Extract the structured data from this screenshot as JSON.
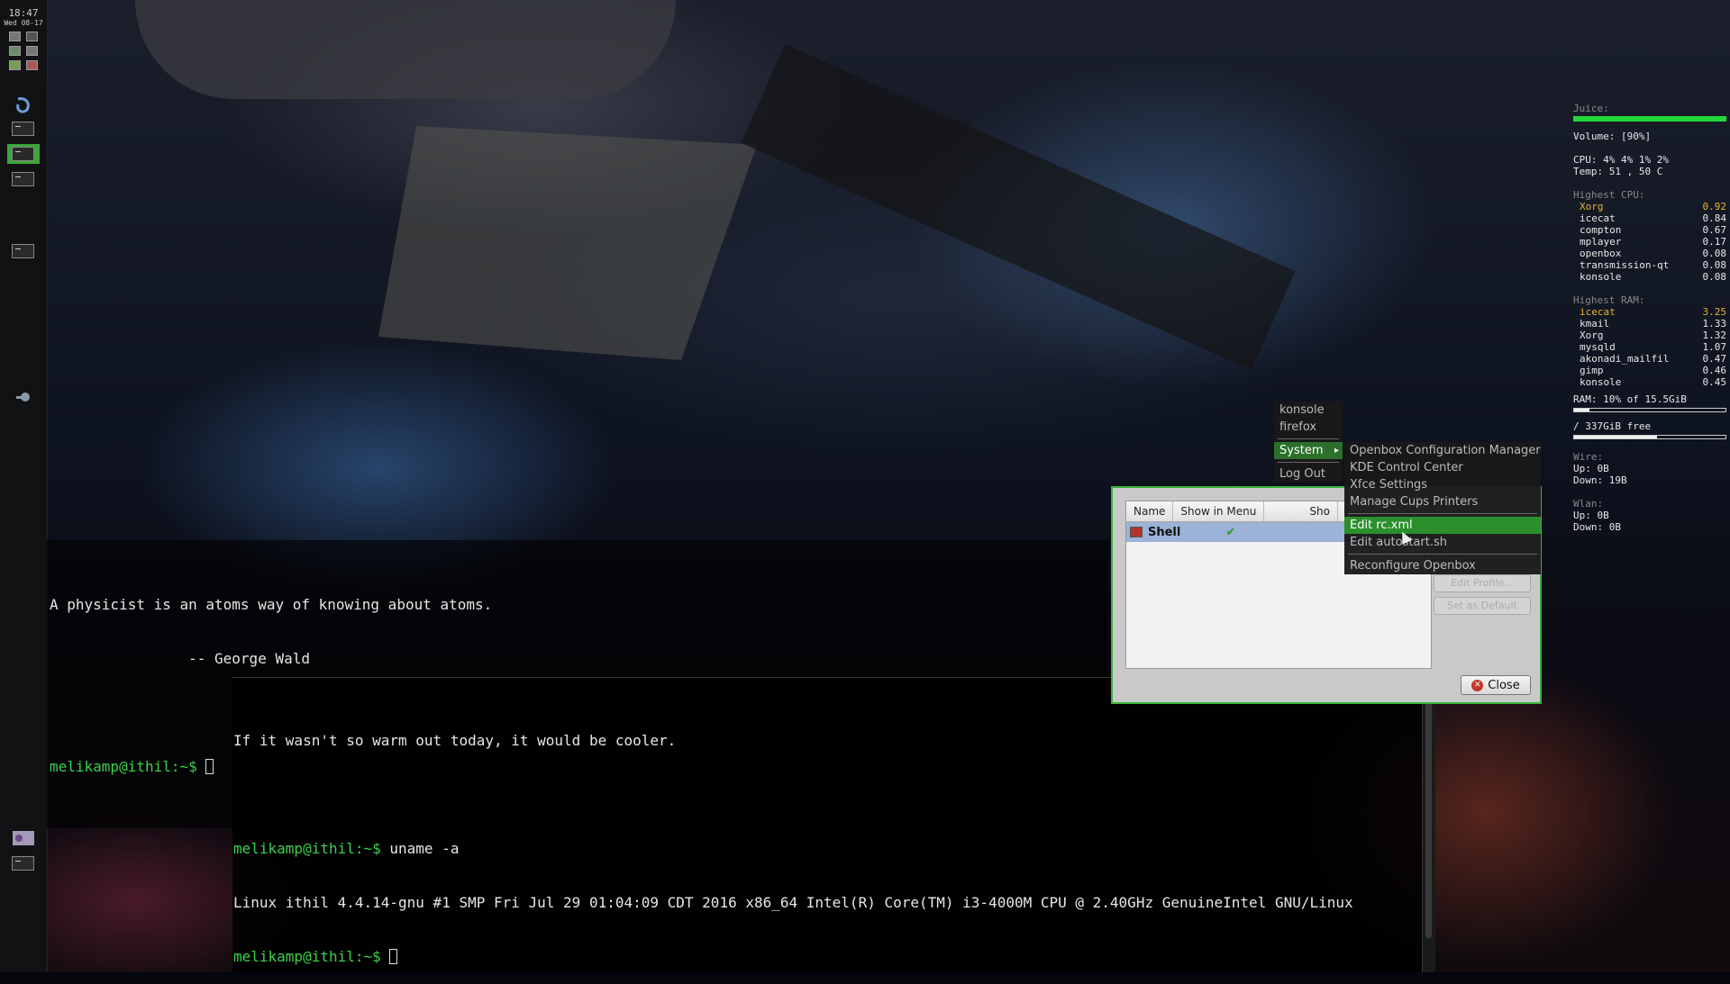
{
  "panel": {
    "clock_time": "18:47",
    "clock_date": "Wed 08-17"
  },
  "terminal1": {
    "quote_line1": "A physicist is an atoms way of knowing about atoms.",
    "quote_line2": "                -- George Wald",
    "prompt": "melikamp@ithil:~$ "
  },
  "terminal2": {
    "quote": "If it wasn't so warm out today, it would be cooler.",
    "prompt1": "melikamp@ithil:~$ ",
    "command": "uname -a",
    "output": "Linux ithil 4.4.14-gnu #1 SMP Fri Jul 29 01:04:09 CDT 2016 x86_64 Intel(R) Core(TM) i3-4000M CPU @ 2.40GHz GenuineIntel GNU/Linux",
    "prompt2": "melikamp@ithil:~$ "
  },
  "conky": {
    "juice_label": "Juice:",
    "juice_level": 1.0,
    "volume": "Volume: [90%]",
    "cpu": "CPU: 4% 4% 1% 2%",
    "temp": "Temp: 51 , 50  C",
    "highest_cpu_label": "Highest CPU:",
    "cpu_procs": [
      {
        "name": "Xorg",
        "value": "0.92"
      },
      {
        "name": "icecat",
        "value": "0.84"
      },
      {
        "name": "compton",
        "value": "0.67"
      },
      {
        "name": "mplayer",
        "value": "0.17"
      },
      {
        "name": "openbox",
        "value": "0.08"
      },
      {
        "name": "transmission-qt",
        "value": "0.08"
      },
      {
        "name": "konsole",
        "value": "0.08"
      }
    ],
    "highest_ram_label": "Highest RAM:",
    "ram_procs": [
      {
        "name": "icecat",
        "value": "3.25"
      },
      {
        "name": "kmail",
        "value": "1.33"
      },
      {
        "name": "Xorg",
        "value": "1.32"
      },
      {
        "name": "mysqld",
        "value": "1.07"
      },
      {
        "name": "akonadi_mailfil",
        "value": "0.47"
      },
      {
        "name": "gimp",
        "value": "0.46"
      },
      {
        "name": "konsole",
        "value": "0.45"
      }
    ],
    "ram": "RAM:  10% of 15.5GiB",
    "ram_level": 0.1,
    "disk": "/    337GiB  free",
    "disk_level": 0.55,
    "wire_label": "Wire:",
    "wire_up": "Up: 0B",
    "wire_down": "Down: 19B",
    "wlan_label": "Wlan:",
    "wlan_up": "Up: 0B",
    "wlan_down": "Down: 0B"
  },
  "dialog": {
    "col_name": "Name",
    "col_show_in_menu": "Show in Menu",
    "col_3": "Sho",
    "row_name": "Shell",
    "row_check": "✔",
    "ghost_btn_1": "Edit Profile...",
    "ghost_btn_2": "Set as Default",
    "close_label": "Close"
  },
  "main_menu": {
    "items": [
      "konsole",
      "firefox",
      "System",
      "Log Out"
    ]
  },
  "system_menu": {
    "items": [
      "Openbox Configuration Manager",
      "KDE Control Center",
      "Xfce Settings",
      "Manage Cups Printers",
      "Edit rc.xml",
      "Edit autostart.sh",
      "Reconfigure Openbox"
    ]
  }
}
